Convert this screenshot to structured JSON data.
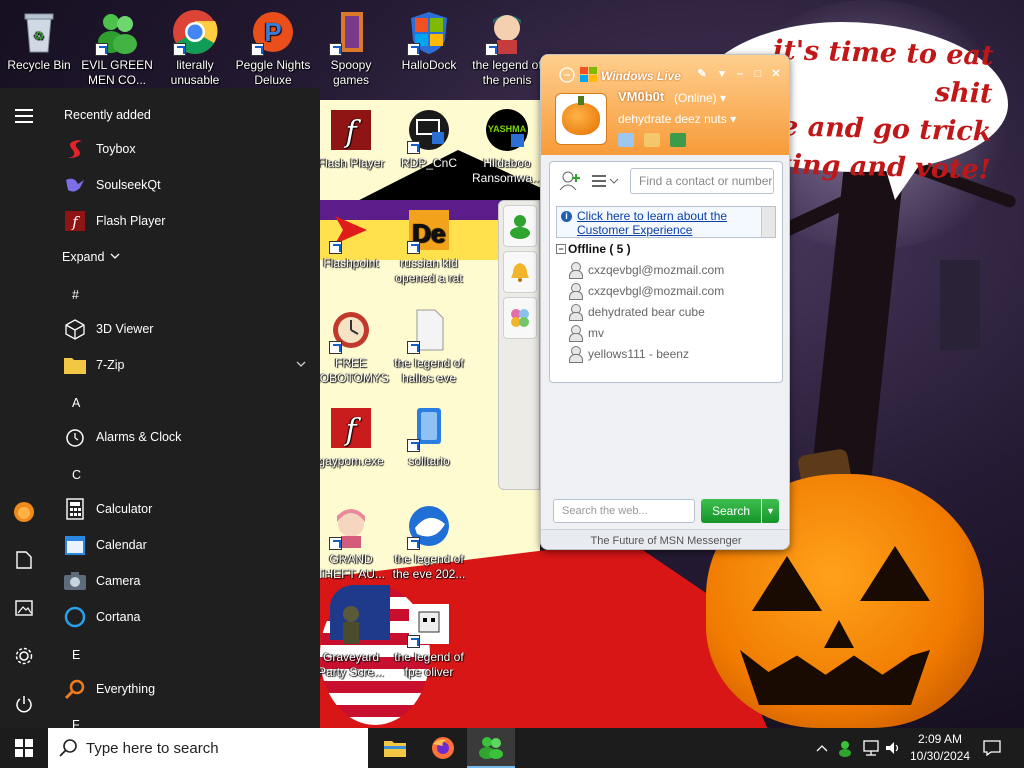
{
  "wallpaper": {
    "speech_bubble": "it's time to eat shit\nie and go trick\nting and vote!"
  },
  "desktop_icons": [
    {
      "label": "Recycle Bin"
    },
    {
      "label": "EVIL GREEN MEN CO..."
    },
    {
      "label": "literally unusable"
    },
    {
      "label": "Peggle Nights Deluxe"
    },
    {
      "label": "Spoopy games"
    },
    {
      "label": "HalloDock"
    },
    {
      "label": "the legend of the penis"
    },
    {
      "label": "Flash Player"
    },
    {
      "label": "RDP_CnC"
    },
    {
      "label": "Hildaboo Ransomwa..."
    },
    {
      "label": "Flashpoint"
    },
    {
      "label": "russian kid opened a rat"
    },
    {
      "label": "FREE LOBOTOMYS"
    },
    {
      "label": "the legend of hallos eve"
    },
    {
      "label": "gaypom.exe"
    },
    {
      "label": "solitario"
    },
    {
      "label": "GRAND THEFT AU..."
    },
    {
      "label": "the legend of the eve 202..."
    },
    {
      "label": "Graveyard Party Scre..."
    },
    {
      "label": "the legend of fpe oliver"
    }
  ],
  "start_menu": {
    "recently_added_header": "Recently added",
    "recent": [
      {
        "label": "Toybox",
        "icon": "toybox-icon"
      },
      {
        "label": "SoulseekQt",
        "icon": "soulseek-bird-icon"
      },
      {
        "label": "Flash Player",
        "icon": "flash-player-icon"
      }
    ],
    "expand_label": "Expand",
    "sections": [
      {
        "letter": "#",
        "apps": [
          {
            "label": "3D Viewer"
          },
          {
            "label": "7-Zip"
          }
        ]
      },
      {
        "letter": "A",
        "apps": [
          {
            "label": "Alarms & Clock"
          }
        ]
      },
      {
        "letter": "C",
        "apps": [
          {
            "label": "Calculator"
          },
          {
            "label": "Calendar"
          },
          {
            "label": "Camera"
          },
          {
            "label": "Cortana"
          }
        ]
      },
      {
        "letter": "E",
        "apps": [
          {
            "label": "Everything"
          }
        ]
      },
      {
        "letter": "F",
        "apps": []
      }
    ]
  },
  "msn": {
    "window_title": "Windows Live",
    "display_name": "VM0b0t",
    "status": "(Online)",
    "personal_message": "dehydrate deez nuts",
    "find_placeholder": "Find a contact or number",
    "banner_link": "Click here to learn about the Customer Experience",
    "group_label": "Offline ( 5 )",
    "contacts": [
      "cxzqevbgl@mozmail.com",
      "cxzqevbgl@mozmail.com",
      "dehydrated bear cube",
      "mv",
      "yellows111 - beenz"
    ],
    "web_search_placeholder": "Search the web...",
    "search_button": "Search",
    "footer": "The Future of MSN Messenger"
  },
  "taskbar": {
    "search_placeholder": "Type here to search",
    "apps": [
      "file-explorer-icon",
      "firefox-icon",
      "msn-messenger-icon"
    ],
    "time": "2:09 AM",
    "date": "10/30/2024"
  },
  "colors": {
    "msn_orange": "#f79b3a",
    "search_green": "#15942a",
    "start_menu_bg": "#1f1f1f",
    "taskbar_bg": "#1c1c1c"
  }
}
